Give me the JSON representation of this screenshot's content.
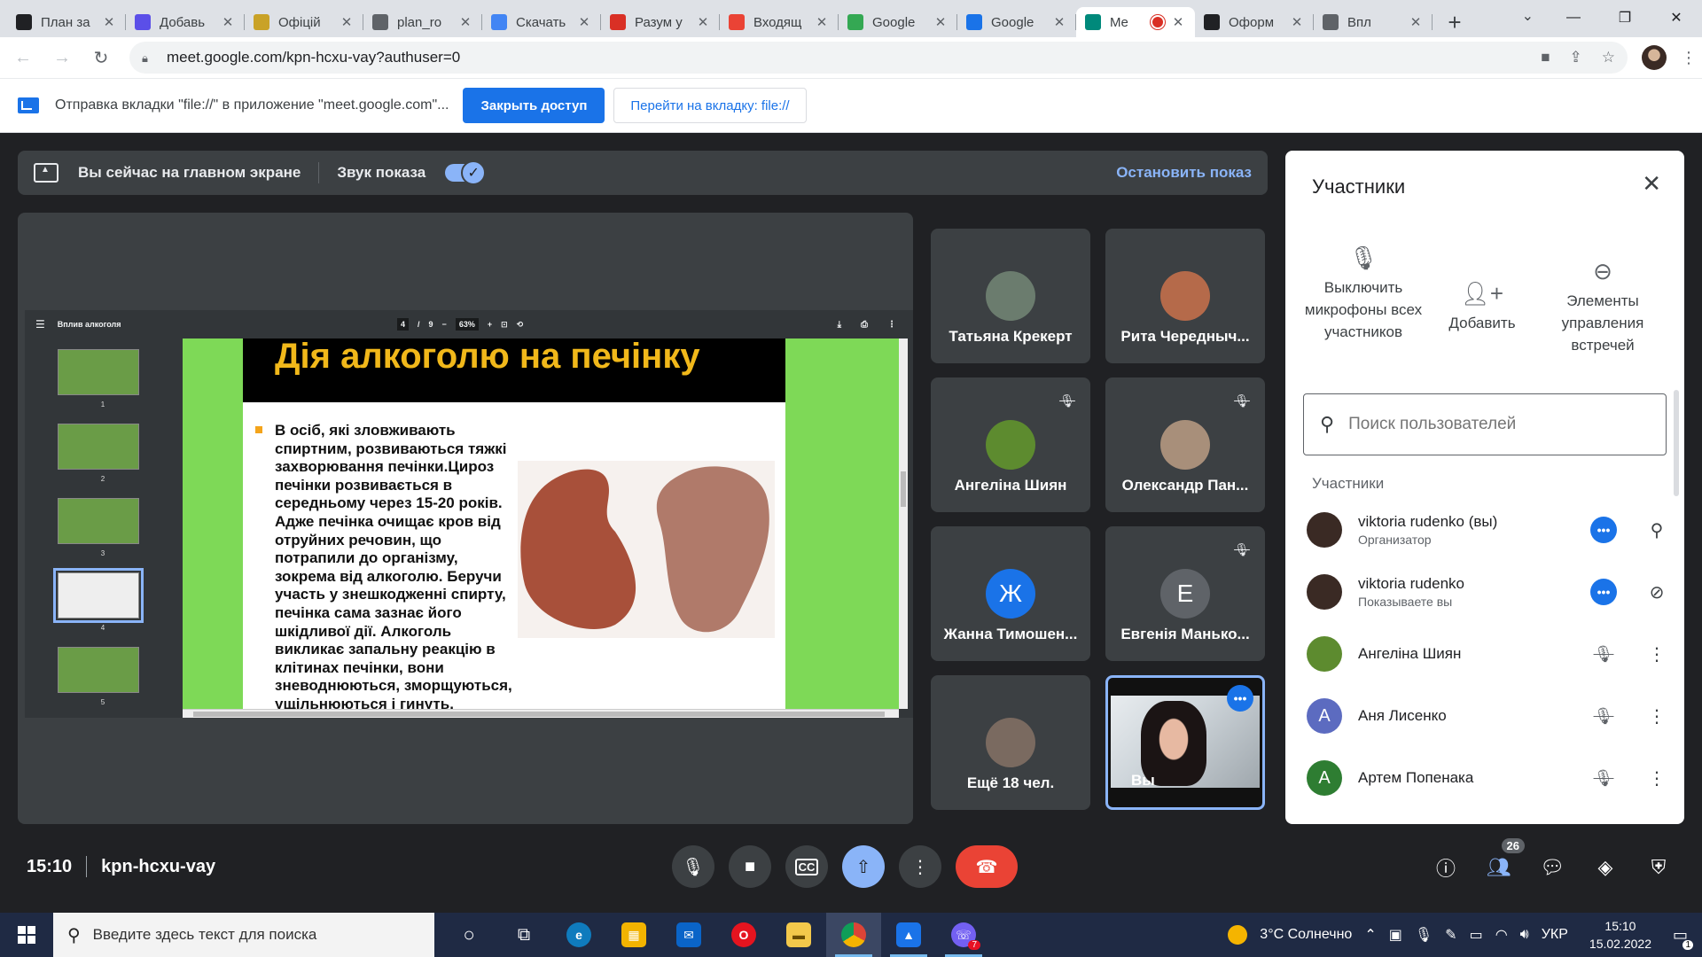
{
  "browser": {
    "tabs": [
      {
        "title": "План за",
        "color": "#202124",
        "icon": "mortarboard-icon"
      },
      {
        "title": "Добавь",
        "color": "#5b4fe8",
        "icon": "shield-icon"
      },
      {
        "title": "Офіцій",
        "color": "#c9a227",
        "icon": "emblem-icon"
      },
      {
        "title": "plan_ro",
        "color": "#5f6368",
        "icon": "globe-icon"
      },
      {
        "title": "Скачать",
        "color": "#4285f4",
        "icon": "download-icon"
      },
      {
        "title": "Разум у",
        "color": "#d93025",
        "icon": "book-icon"
      },
      {
        "title": "Входящ",
        "color": "#ea4335",
        "icon": "gmail-icon"
      },
      {
        "title": "Google",
        "color": "#34a853",
        "icon": "google-icon"
      },
      {
        "title": "Google",
        "color": "#1a73e8",
        "icon": "calendar-icon"
      },
      {
        "title": "Me",
        "color": "#00897b",
        "icon": "meet-icon",
        "active": true,
        "recording": true
      },
      {
        "title": "Оформ",
        "color": "#202124",
        "icon": "u-icon"
      },
      {
        "title": "Впл",
        "color": "#5f6368",
        "icon": "globe-icon"
      }
    ],
    "url": "meet.google.com/kpn-hcxu-vay?authuser=0",
    "infobar": {
      "message": "Отправка вкладки \"file://\" в приложение \"meet.google.com\"...",
      "primary_button": "Закрыть доступ",
      "secondary_button": "Перейти на вкладку: file://"
    }
  },
  "meet": {
    "presenting_bar": {
      "message": "Вы сейчас на главном экране",
      "audio_label": "Звук показа",
      "audio_on": true,
      "stop_label": "Остановить показ"
    },
    "pdf": {
      "doc_title": "Вплив алкоголя",
      "page_current": "4",
      "page_sep": "/",
      "page_total": "9",
      "zoom": "63%",
      "thumbnails": [
        "1",
        "2",
        "3",
        "4",
        "5"
      ],
      "selected_thumbnail": 3,
      "slide_title": "Дія алкоголю на печінку",
      "slide_text": "В осіб, які зловживають спиртним, розвиваються тяжкі захворювання печінки.Цироз печінки розвивається в середньому через 15-20 років. Адже печінка очищає кров від отруйних речовин, що потрапили до організму, зокрема від алкоголю. Беручи участь у знешкодженні спирту, печінка сама зазнає його шкідливої дії. Алкоголь викликає запальну реакцію в клітинах печінки, вони зневоднюються, зморщуються, ущільнюються і гинуть."
    },
    "tiles": [
      {
        "name": "Татьяна Крекерт",
        "muted": false,
        "avatar_color": "#6b7c6e"
      },
      {
        "name": "Рита Чередныч...",
        "muted": false,
        "avatar_color": "#b56a4a"
      },
      {
        "name": "Ангеліна Шиян",
        "muted": true,
        "avatar_color": "#5d8b2f"
      },
      {
        "name": "Олександр Пан...",
        "muted": true,
        "avatar_color": "#a88f7a"
      },
      {
        "name": "Жанна Тимошен...",
        "muted": false,
        "avatar_color": "#1a73e8",
        "initial": "Ж"
      },
      {
        "name": "Евгенія Манько...",
        "muted": true,
        "avatar_color": "#5f6368",
        "initial": "Е"
      },
      {
        "name": "Ещё 18 чел.",
        "muted": false,
        "avatar_color": "#7a6a60"
      },
      {
        "name": "Вы",
        "self": true
      }
    ],
    "clock": "15:10",
    "meeting_code": "kpn-hcxu-vay",
    "people_count": "26",
    "participants_panel": {
      "title": "Участники",
      "actions": [
        {
          "label": "Выключить микрофоны всех участников",
          "icon": "mic-off-icon"
        },
        {
          "label": "Добавить",
          "icon": "person-add-icon"
        },
        {
          "label": "Элементы управления встречей",
          "icon": "toggle-icon"
        }
      ],
      "search_placeholder": "Поиск пользователей",
      "section_label": "Участники",
      "people": [
        {
          "name": "viktoria rudenko (вы)",
          "role": "Организатор",
          "avatar_color": "#3a2a24",
          "dots": true,
          "side_icon": "pin-icon"
        },
        {
          "name": "viktoria rudenko",
          "role": "Показываете вы",
          "avatar_color": "#3a2a24",
          "dots": true,
          "side_icon": "unpin-icon"
        },
        {
          "name": "Ангеліна Шиян",
          "role": "",
          "avatar_color": "#5d8b2f",
          "muted": true
        },
        {
          "name": "Аня Лисенко",
          "role": "",
          "avatar_color": "#5c6bc0",
          "initial": "А",
          "muted": true
        },
        {
          "name": "Артем Попенака",
          "role": "",
          "avatar_color": "#2e7d32",
          "initial": "А",
          "muted": true
        }
      ]
    }
  },
  "taskbar": {
    "search_placeholder": "Введите здесь текст для поиска",
    "weather": "3°C  Солнечно",
    "language": "УКР",
    "time": "15:10",
    "date": "15.02.2022",
    "notifications": "1",
    "viber_badge": "7"
  }
}
